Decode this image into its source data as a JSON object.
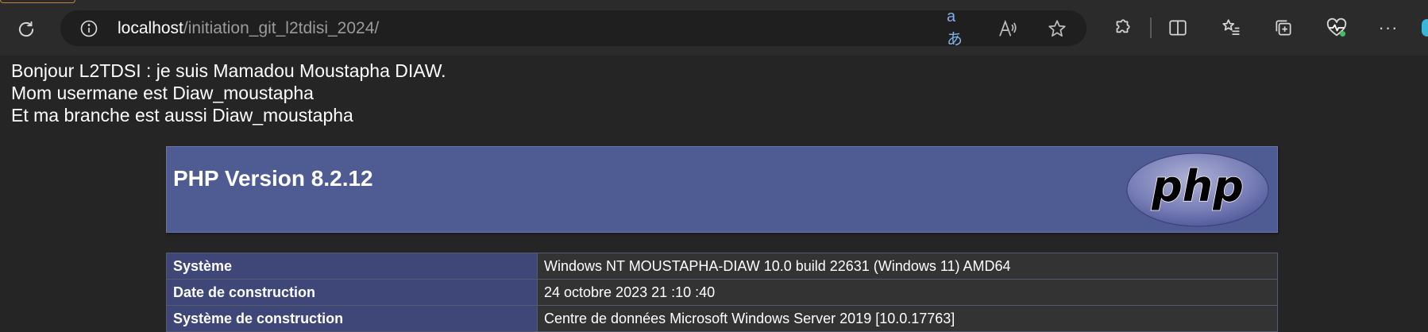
{
  "browser": {
    "url_host": "localhost",
    "url_path": "/initiation_git_l2tdisi_2024/",
    "translate_glyph": "aあ",
    "more_glyph": "···",
    "icons": [
      "reload-icon",
      "info-icon",
      "translate-icon",
      "read-aloud-icon",
      "favorite-star-icon",
      "extensions-icon",
      "split-screen-icon",
      "favorites-icon",
      "collections-icon",
      "browser-essentials-icon",
      "more-icon"
    ]
  },
  "intro": {
    "line1": "Bonjour L2TDSI : je suis Mamadou Moustapha DIAW.",
    "line2": "Mom usermane est Diaw_moustapha",
    "line3": "Et ma branche est aussi Diaw_moustapha"
  },
  "phpinfo": {
    "title": "PHP Version 8.2.12",
    "logo_text": "php",
    "rows": [
      {
        "key": "Système",
        "value": "Windows NT MOUSTAPHA-DIAW 10.0 build 22631 (Windows 11) AMD64"
      },
      {
        "key": "Date de construction",
        "value": "24 octobre 2023 21 :10 :40"
      },
      {
        "key": "Système de construction",
        "value": "Centre de données Microsoft Windows Server 2019 [10.0.17763]"
      }
    ]
  },
  "colors": {
    "toolbar_bg": "#2b2b2b",
    "page_bg": "#252526",
    "php_header_bg": "#4f5b93",
    "table_key_bg": "#3f4778",
    "table_value_bg": "#333333"
  }
}
